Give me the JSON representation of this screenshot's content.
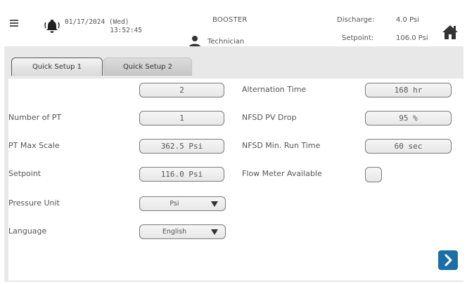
{
  "header": {
    "date": "01/17/2024 (Wed)",
    "time": "13:52:45",
    "app_title": "BOOSTER",
    "user_role": "Technician",
    "discharge_label": "Discharge:",
    "discharge_value": "4.0 Psi",
    "setpoint_label": "Setpoint:",
    "setpoint_value": "106.0 Psi",
    "icons": [
      "menu-icon",
      "alarm-icon",
      "user-icon",
      "home-icon"
    ]
  },
  "tabs": [
    {
      "label": "Quick Setup 1",
      "active": true
    },
    {
      "label": "Quick Setup 2",
      "active": false
    }
  ],
  "left_settings": {
    "row0_value": "2",
    "number_of_pt": {
      "label": "Number of PT",
      "value": "1"
    },
    "pt_max_scale": {
      "label": "PT Max Scale",
      "value": "362.5 Psi"
    },
    "setpoint": {
      "label": "Setpoint",
      "value": "116.0 Psi"
    },
    "pressure_unit": {
      "label": "Pressure Unit",
      "value": "Psi"
    },
    "language": {
      "label": "Language",
      "value": "English"
    }
  },
  "right_settings": {
    "alternation_time": {
      "label": "Alternation Time",
      "value": "168 hr"
    },
    "nfsd_pv_drop": {
      "label": "NFSD PV Drop",
      "value": "95 %"
    },
    "nfsd_min_run_time": {
      "label": "NFSD Min. Run Time",
      "value": "60 sec"
    },
    "flow_meter_available": {
      "label": "Flow Meter Available",
      "checked": false
    }
  },
  "colors": {
    "accent": "#1a6fa8",
    "tab_strip": "#e8e8e8"
  }
}
